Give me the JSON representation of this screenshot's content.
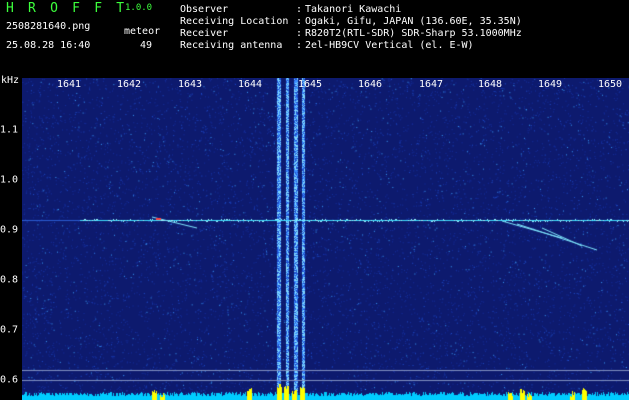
{
  "app": {
    "title": "H R O F F T",
    "version": "1.0.0"
  },
  "file": {
    "name": "2508281640.png",
    "timestamp": "25.08.28 16:40"
  },
  "meteor": {
    "label": "meteor",
    "count": "49"
  },
  "info": [
    {
      "label": "Observer",
      "value": "Takanori Kawachi"
    },
    {
      "label": "Receiving Location",
      "value": "Ogaki, Gifu, JAPAN (136.60E, 35.35N)"
    },
    {
      "label": "Receiver",
      "value": "R820T2(RTL-SDR) SDR-Sharp 53.1000MHz"
    },
    {
      "label": "Receiving antenna",
      "value": "2el-HB9CV Vertical (el. E-W)"
    }
  ],
  "axis": {
    "unit": "kHz",
    "freq_labels": [
      "1641",
      "1642",
      "1643",
      "1644",
      "1645",
      "1646",
      "1647",
      "1648",
      "1649",
      "1650"
    ],
    "y_labels": [
      "1.1",
      "1.0",
      "0.9",
      "0.8",
      "0.7",
      "0.6"
    ]
  },
  "colors": {
    "title": "#3cff3c",
    "text": "#ffffff",
    "background": "#000000",
    "spectrogram_bg": "#0d1a6e",
    "signal": "#00e5ff",
    "peak": "#ffff00"
  }
}
